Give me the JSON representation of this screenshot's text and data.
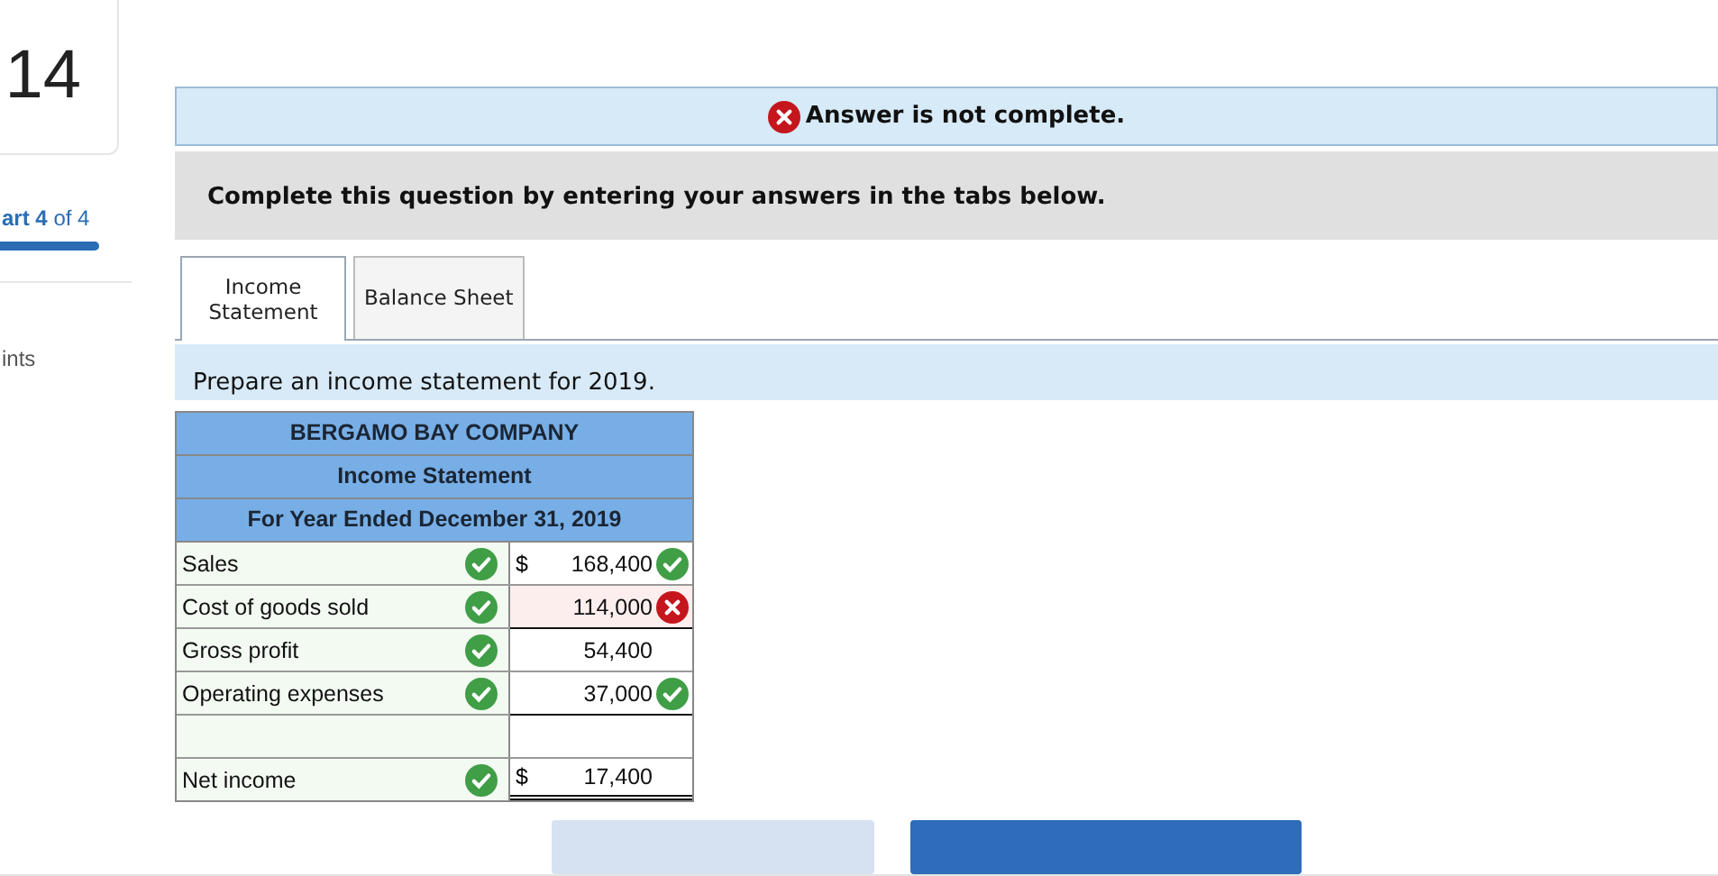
{
  "sidebar": {
    "question_number": "14",
    "part": "**art 4** of 4",
    "progress": {
      "level": 1
    },
    "points_label": "ints"
  },
  "feedback": {
    "complete": false,
    "message": "Answer is not complete."
  },
  "instructions": "Complete this question by entering your answers in the tabs below.",
  "tabs": [
    {
      "label": "Income\nStatement",
      "selected": true
    },
    {
      "label": "Balance Sheet",
      "selected": false
    }
  ],
  "prompt": "Prepare an income statement for 2019.",
  "statement": {
    "headings": [
      "BERGAMO BAY COMPANY",
      "Income Statement",
      "For Year Ended December 31, 2019"
    ],
    "rows": [
      {
        "label": "Sales",
        "label_correct": true,
        "currency": "$",
        "amount": "168,400",
        "amount_correct": true,
        "amount_wrong": false,
        "rule_below": false,
        "double_rule": false
      },
      {
        "label": "Cost of goods sold",
        "label_correct": true,
        "amount": "114,000",
        "amount_correct": false,
        "amount_wrong": true,
        "rule_below": true,
        "double_rule": false
      },
      {
        "label": "Gross profit",
        "label_correct": true,
        "amount": "54,400",
        "amount_correct": false,
        "amount_wrong": false,
        "rule_below": false,
        "double_rule": false
      },
      {
        "label": "Operating expenses",
        "label_correct": true,
        "amount": "37,000",
        "amount_correct": true,
        "amount_wrong": false,
        "rule_below": true,
        "double_rule": false
      },
      {
        "label_correct": false,
        "amount_correct": false,
        "amount_wrong": false,
        "rule_below": false,
        "double_rule": false
      },
      {
        "label": "Net income",
        "label_correct": true,
        "currency": "$",
        "amount": "17,400",
        "amount_correct": false,
        "amount_wrong": false,
        "rule_below": false,
        "double_rule": true
      }
    ]
  },
  "nav_buttons": [
    {
      "disabled": true
    },
    {
      "disabled": false
    }
  ]
}
